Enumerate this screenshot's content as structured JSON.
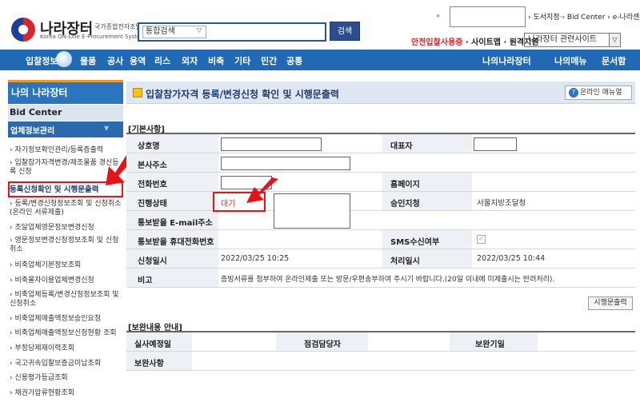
{
  "header": {
    "logo_title": "나라장터",
    "logo_sub_kr": "국가종합전자조달",
    "logo_sub_en": "Korea ON-Line E-Procurement System",
    "search_select": "통합검색",
    "search_button": "검색",
    "top_links": "› 도서지정·› Bid Center  › e-나라센터",
    "safe_links_red": "안전입찰사용증",
    "safe_links_rest": " · 사이트맵 · 원격지원",
    "related_site": "나라장터 관련사이트"
  },
  "nav": {
    "items": [
      "입찰정보",
      "물품",
      "공사",
      "용역",
      "리스",
      "외자",
      "비축",
      "기타",
      "민간",
      "공통"
    ],
    "right_items": [
      "나의나라장터",
      "나의메뉴",
      "문서함"
    ]
  },
  "sidebar": {
    "title": "나의 나라장터",
    "bid_center": "Bid Center",
    "section": "업체정보관리",
    "items": [
      "› 자기정보확인관리/등록증출력",
      "› 입찰참가자격변경/제조물품 경신등록 신청",
      "등록신청확인 및 시행문출력",
      "› 등록/변경신청정보조회 및 신청취소 (온라인 서류제출)",
      "› 조달업체영문정보변경신청",
      "› 영문정보변경신청정보조회 및 신청취소",
      "› 비축업체기본정보조회",
      "› 비축물자이용업체변경신청",
      "› 비축업체등록/변경신청정보조회 및 신청취소",
      "› 비축업체매출액정보승인요청",
      "› 비축업체매출액정보신청현황 조회",
      "› 부정당제재이력조회",
      "› 국고귀속입찰보증금미납조회",
      "› 신용평가등급조회",
      "› 채권가압류현황조회"
    ]
  },
  "content": {
    "title": "입찰참가자격 등록/변경신청 확인 및 시행문출력",
    "manual_button": "온라인 매뉴얼",
    "basic_section": "[기본사항]",
    "fields": {
      "company_name": "상호명",
      "representative": "대표자",
      "address": "본사주소",
      "phone": "전화번호",
      "homepage": "홈페이지",
      "status_label": "진행상태",
      "status_value": "대기",
      "approval_office_label": "승인지청",
      "approval_office_value": "서울지방조달청",
      "email_label": "통보받을 E-mail주소",
      "mobile_label": "통보받을 휴대전화번호",
      "sms_label": "SMS수신여부",
      "apply_date_label": "신청일시",
      "apply_date_value": "2022/03/25 10:25",
      "process_date_label": "처리일시",
      "process_date_value": "2022/03/25 10:44",
      "remark_label": "비고",
      "remark_value": "증빙서류를 첨부하여 온라인제출 또는 방문/우편송부하여 주시기 바랍니다.(20일 이내에 미제출시는 반려처리)."
    },
    "print_button": "시행문출력",
    "supp_section": "[보완내용 안내]",
    "supp": {
      "due_label": "실사예정일",
      "officer_label": "점검담당자",
      "deadline_label": "보완기일",
      "content_label": "보완사항"
    }
  }
}
